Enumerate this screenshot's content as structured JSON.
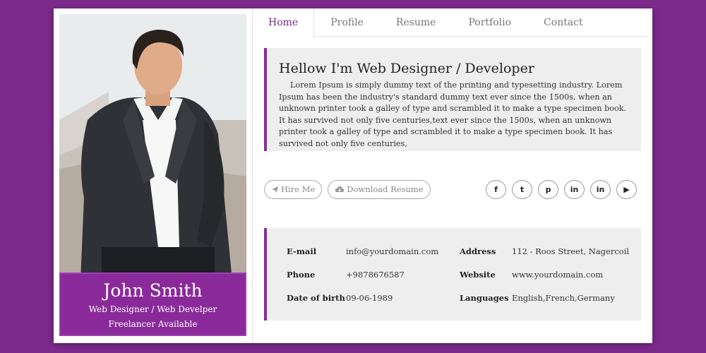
{
  "profile": {
    "name": "John Smith",
    "role": "Web Designer / Web Develper",
    "availability": "Freelancer Available"
  },
  "tabs": [
    "Home",
    "Profile",
    "Resume",
    "Portfolio",
    "Contact"
  ],
  "active_tab": "Home",
  "intro": {
    "heading": "Hellow I'm Web Designer / Developer",
    "text": "Lorem Ipsum is simply dummy text of the printing and typesetting industry. Lorem Ipsum has been the industry's standard dummy text ever since the 1500s, when an unknown printer took a galley of type and scrambled it to make a type specimen book. It has survived not only five centuries,text ever since the 1500s, when an unknown printer took a galley of type and scrambled it to make a type specimen book. It has survived not only five centuries,"
  },
  "actions": {
    "hire_label": "Hire Me",
    "download_label": "Download Resume"
  },
  "social": [
    {
      "name": "facebook-icon",
      "glyph": "f"
    },
    {
      "name": "twitter-icon",
      "glyph": "t"
    },
    {
      "name": "pinterest-icon",
      "glyph": "p"
    },
    {
      "name": "linkedin-icon",
      "glyph": "in"
    },
    {
      "name": "linkedin-icon",
      "glyph": "in"
    },
    {
      "name": "youtube-icon",
      "glyph": "▶"
    }
  ],
  "info": {
    "email_label": "E-mail",
    "email": "info@yourdomain.com",
    "address_label": "Address",
    "address": "112 - Roos Street, Nagercoil",
    "phone_label": "Phone",
    "phone": "+9878676587",
    "website_label": "Website",
    "website": "www.yourdomain.com",
    "dob_label": "Date of birth",
    "dob": "09-06-1989",
    "languages_label": "Languages",
    "languages": "English,French,Germany"
  },
  "colors": {
    "background": "#7b2a8b",
    "accent": "#8a2a9a",
    "panel": "#eeeeee"
  }
}
